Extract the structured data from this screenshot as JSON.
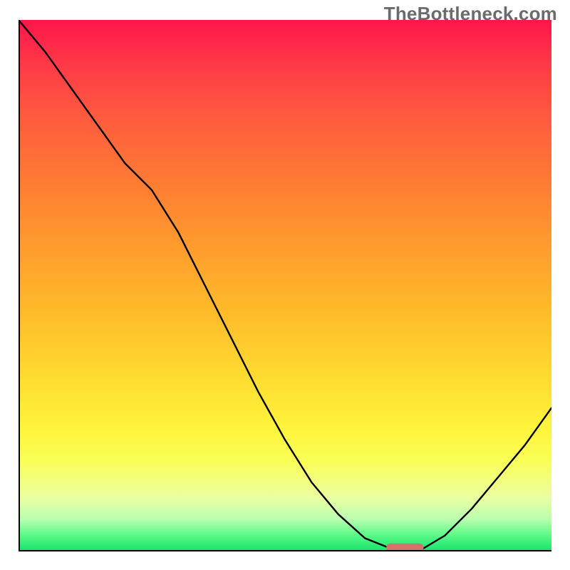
{
  "watermark": "TheBottleneck.com",
  "chart_data": {
    "type": "line",
    "title": "",
    "xlabel": "",
    "ylabel": "",
    "x": [
      0.0,
      0.05,
      0.1,
      0.15,
      0.2,
      0.25,
      0.3,
      0.35,
      0.4,
      0.45,
      0.5,
      0.55,
      0.6,
      0.65,
      0.7,
      0.725,
      0.75,
      0.8,
      0.85,
      0.9,
      0.95,
      1.0
    ],
    "values": [
      1.0,
      0.94,
      0.87,
      0.8,
      0.73,
      0.68,
      0.6,
      0.5,
      0.4,
      0.3,
      0.21,
      0.13,
      0.07,
      0.025,
      0.005,
      0.0,
      0.0,
      0.03,
      0.08,
      0.14,
      0.2,
      0.27
    ],
    "minimum_marker": {
      "x_start": 0.69,
      "x_end": 0.76,
      "y": 0.007
    },
    "xlim": [
      0,
      1
    ],
    "ylim": [
      0,
      1
    ],
    "grid": false,
    "legend": null,
    "description": "Single black V-shaped curve descending steeply from top-left, reaching a flat minimum near x≈0.72, then rising toward the right. A short horizontal salmon-colored marker sits at the minimum on the baseline."
  }
}
